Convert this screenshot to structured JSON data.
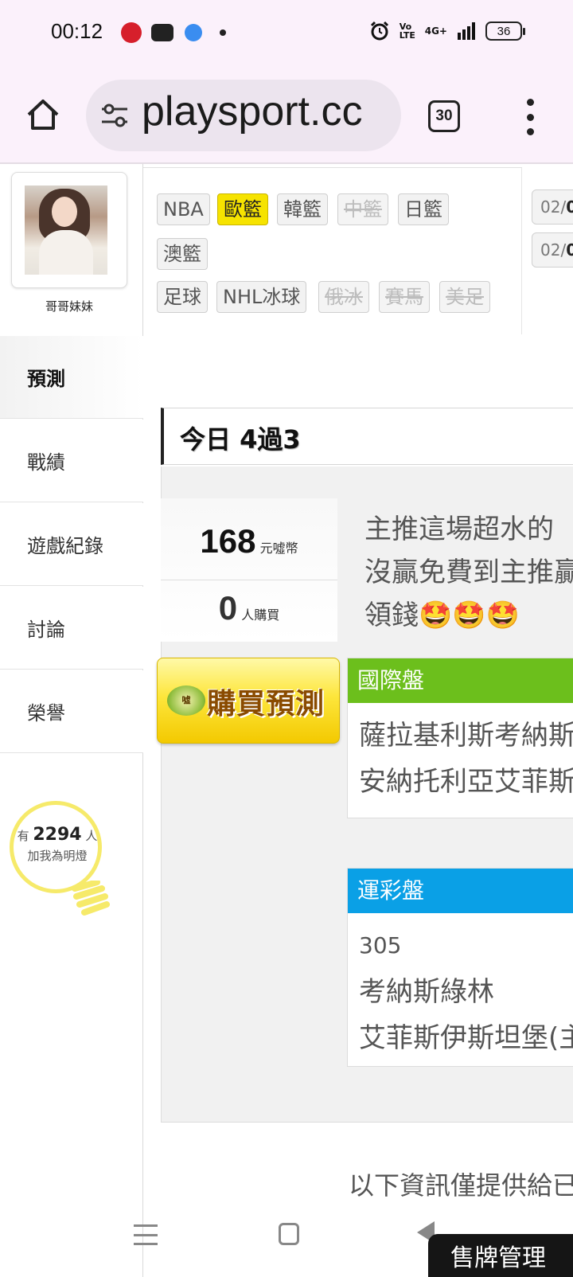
{
  "status_bar": {
    "time": "00:12",
    "network_label": "Vo LTE",
    "signal_label": "4G+",
    "battery": "36"
  },
  "browser": {
    "url": "playsport.cc",
    "tab_count": "30"
  },
  "profile": {
    "name": "哥哥妹妹"
  },
  "sidebar": {
    "items": [
      {
        "label": "預測"
      },
      {
        "label": "戰績"
      },
      {
        "label": "遊戲紀錄"
      },
      {
        "label": "討論"
      },
      {
        "label": "榮譽"
      }
    ],
    "fans": {
      "prefix": "有",
      "count": "2294",
      "suffix": "人",
      "caption": "加我為明燈"
    }
  },
  "leagues": {
    "row1": [
      {
        "label": "NBA",
        "state": "normal"
      },
      {
        "label": "歐籃",
        "state": "active"
      },
      {
        "label": "韓籃",
        "state": "normal"
      },
      {
        "label": "中籃",
        "state": "disabled"
      },
      {
        "label": "日籃",
        "state": "normal"
      }
    ],
    "row2": [
      {
        "label": "澳籃",
        "state": "normal"
      }
    ],
    "row3": [
      {
        "label": "足球",
        "state": "normal"
      },
      {
        "label": "NHL冰球",
        "state": "normal"
      },
      {
        "label": "俄冰",
        "state": "disabled"
      },
      {
        "label": "賽馬",
        "state": "disabled"
      },
      {
        "label": "美足",
        "state": "disabled"
      }
    ]
  },
  "dates": [
    {
      "prefix": "02/",
      "bold": "0"
    },
    {
      "prefix": "02/",
      "bold": "0"
    }
  ],
  "prediction": {
    "day_title": "今日 4過3",
    "price": "168",
    "price_unit": "元噓幣",
    "buyers": "0",
    "buyers_unit": "人購買",
    "buy_badge": "噓",
    "buy_button": "購買預測",
    "post_lines": [
      "主推這場超水的",
      "沒贏免費到主推贏",
      "領錢🤩🤩🤩"
    ],
    "intl_market": {
      "title": "國際盤",
      "color": "#6cbf1c",
      "lines": [
        "薩拉基利斯考納斯",
        "安納托利亞艾菲斯"
      ]
    },
    "lottery_market": {
      "title": "運彩盤",
      "color": "#0aa0e6",
      "code": "305",
      "lines": [
        "考納斯綠林",
        "艾菲斯伊斯坦堡(主"
      ]
    }
  },
  "footer_note": "以下資訊僅提供給已",
  "fab_label": "售牌管理"
}
